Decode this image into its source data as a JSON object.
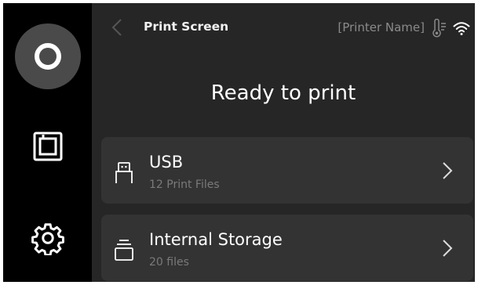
{
  "sidebar": {
    "items": [
      {
        "icon": "home-ring-icon"
      },
      {
        "icon": "storage-icon"
      },
      {
        "icon": "gear-icon"
      }
    ]
  },
  "topbar": {
    "back_icon": "chevron-left-icon",
    "title": "Print Screen",
    "printer_name": "[Printer Name]",
    "status_icons": [
      "thermometer-icon",
      "wifi-icon"
    ]
  },
  "main": {
    "heading": "Ready to print",
    "sources": [
      {
        "label": "USB",
        "subtitle": "12 Print Files",
        "icon": "usb-icon"
      },
      {
        "label": "Internal Storage",
        "subtitle": "20 files",
        "icon": "internal-storage-icon"
      }
    ]
  },
  "colors": {
    "sidebar_bg": "#000000",
    "main_bg": "#262626",
    "card_bg": "#333333",
    "home_button_bg": "#4a4a4a",
    "text_primary": "#ffffff",
    "text_secondary": "#7a7a7a"
  }
}
